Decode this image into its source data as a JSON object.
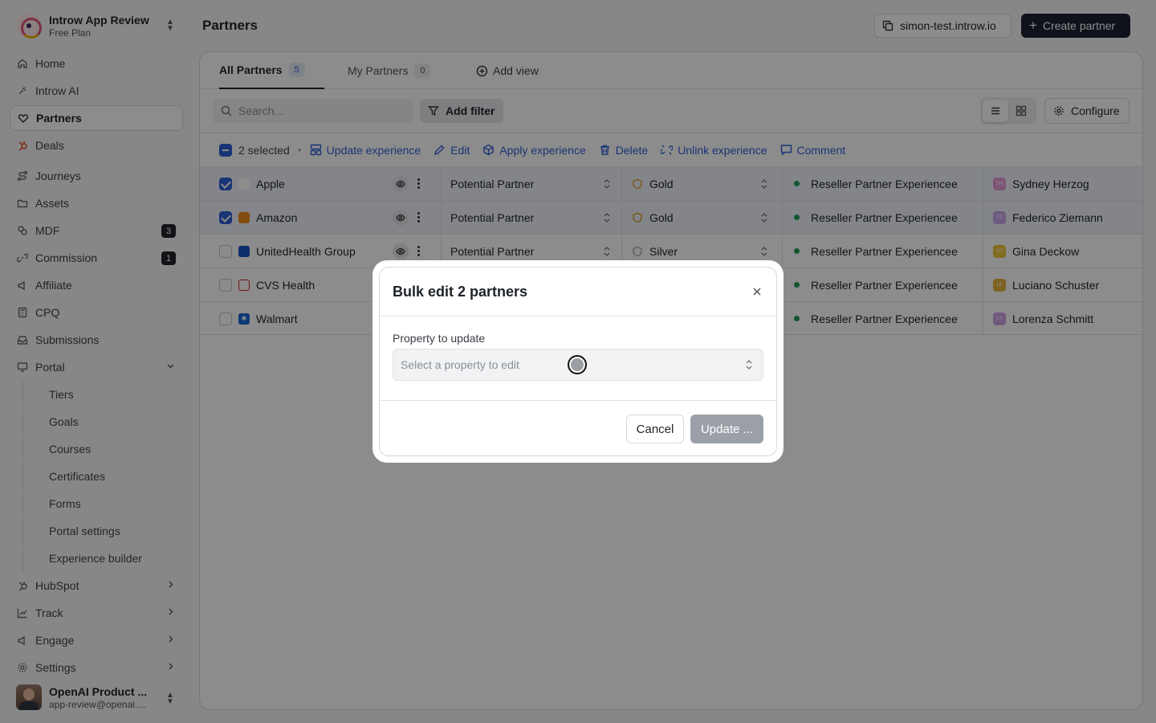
{
  "org": {
    "name": "Introw App Review",
    "plan": "Free Plan"
  },
  "nav": [
    {
      "label": "Home",
      "icon": "home-icon"
    },
    {
      "label": "Introw AI",
      "icon": "sparkle-icon"
    },
    {
      "label": "Partners",
      "icon": "handshake-icon",
      "active": true
    },
    {
      "label": "Deals",
      "icon": "hubspot-icon"
    },
    {
      "label": "Journeys",
      "icon": "route-icon"
    },
    {
      "label": "Assets",
      "icon": "folder-icon"
    },
    {
      "label": "MDF",
      "icon": "coins-icon",
      "badge": "3"
    },
    {
      "label": "Commission",
      "icon": "link-icon",
      "badge": "1"
    },
    {
      "label": "Affiliate",
      "icon": "megaphone-icon"
    },
    {
      "label": "CPQ",
      "icon": "calculator-icon"
    },
    {
      "label": "Submissions",
      "icon": "inbox-icon"
    },
    {
      "label": "Portal",
      "icon": "monitor-icon"
    }
  ],
  "portal_sub": [
    "Tiers",
    "Goals",
    "Courses",
    "Certificates",
    "Forms",
    "Portal settings",
    "Experience builder"
  ],
  "nav_bottom": [
    {
      "label": "HubSpot",
      "icon": "hubspot-icon"
    },
    {
      "label": "Track",
      "icon": "chart-icon"
    },
    {
      "label": "Engage",
      "icon": "megaphone-icon"
    },
    {
      "label": "Settings",
      "icon": "gear-icon"
    }
  ],
  "user": {
    "name": "OpenAI Product ...",
    "email": "app-review@openai...."
  },
  "header": {
    "title": "Partners",
    "domain": "simon-test.introw.io",
    "create": "Create partner"
  },
  "tabs": [
    {
      "label": "All Partners",
      "count": "5"
    },
    {
      "label": "My Partners",
      "count": "0"
    },
    {
      "label": "Add view"
    }
  ],
  "toolbar": {
    "search_placeholder": "Search...",
    "filter": "Add filter",
    "configure": "Configure"
  },
  "bulk": {
    "selected": "2 selected",
    "actions": [
      "Update experience",
      "Edit",
      "Apply experience",
      "Delete",
      "Unlink experience",
      "Comment"
    ]
  },
  "rows": [
    {
      "name": "Apple",
      "status": "Potential Partner",
      "tier": "Gold",
      "experience": "Reseller Partner Experiencee",
      "owner": "Sydney Herzog",
      "selected": true,
      "logo_color": "#ffffff",
      "tier_color": "#d9a21b",
      "owner_color": "#e59bd9"
    },
    {
      "name": "Amazon",
      "status": "Potential Partner",
      "tier": "Gold",
      "experience": "Reseller Partner Experiencee",
      "owner": "Federico Ziemann",
      "selected": true,
      "logo_color": "#f08a1c",
      "tier_color": "#d9a21b",
      "owner_color": "#c9a5e6"
    },
    {
      "name": "UnitedHealth Group",
      "status": "Potential Partner",
      "tier": "Silver",
      "experience": "Reseller Partner Experiencee",
      "owner": "Gina Deckow",
      "selected": false,
      "logo_color": "#1a57c8",
      "tier_color": "#a7acb2",
      "owner_color": "#efc53a"
    },
    {
      "name": "CVS Health",
      "status": "",
      "tier": "",
      "experience": "Reseller Partner Experiencee",
      "owner": "Luciano Schuster",
      "selected": false,
      "logo_color": "#cc1f1f",
      "tier_color": "#a7acb2",
      "owner_color": "#e3b23c"
    },
    {
      "name": "Walmart",
      "status": "",
      "tier": "",
      "experience": "Reseller Partner Experiencee",
      "owner": "Lorenza Schmitt",
      "selected": false,
      "logo_color": "#1a69d6",
      "tier_color": "#a7acb2",
      "owner_color": "#cfa0e3"
    }
  ],
  "modal": {
    "title": "Bulk edit 2 partners",
    "label": "Property to update",
    "placeholder": "Select a property to edit",
    "cancel": "Cancel",
    "update": "Update ..."
  }
}
